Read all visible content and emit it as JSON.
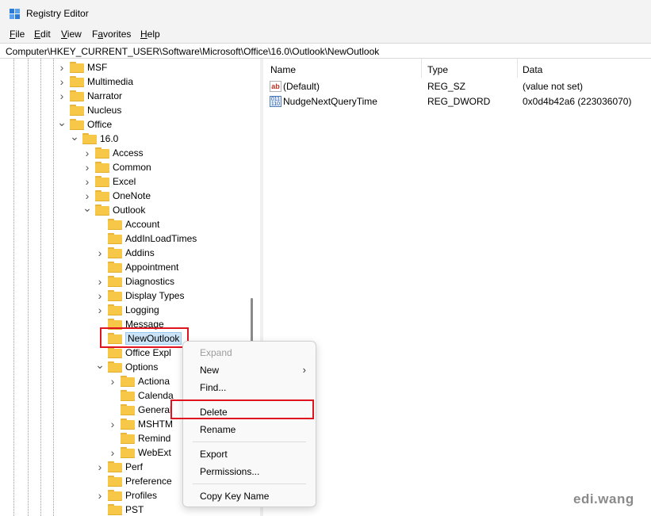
{
  "window": {
    "title": "Registry Editor"
  },
  "menu": [
    "File",
    "Edit",
    "View",
    "Favorites",
    "Help"
  ],
  "menu_mnemonics": [
    "F",
    "E",
    "V",
    "a",
    "H"
  ],
  "address": "Computer\\HKEY_CURRENT_USER\\Software\\Microsoft\\Office\\16.0\\Outlook\\NewOutlook",
  "tree": [
    {
      "label": "MSF",
      "chev": "right"
    },
    {
      "label": "Multimedia",
      "chev": "right"
    },
    {
      "label": "Narrator",
      "chev": "right"
    },
    {
      "label": "Nucleus",
      "chev": "none"
    },
    {
      "label": "Office",
      "chev": "down"
    },
    {
      "label": "16.0",
      "chev": "down"
    },
    {
      "label": "Access",
      "chev": "right"
    },
    {
      "label": "Common",
      "chev": "right"
    },
    {
      "label": "Excel",
      "chev": "right"
    },
    {
      "label": "OneNote",
      "chev": "right"
    },
    {
      "label": "Outlook",
      "chev": "down"
    },
    {
      "label": "Account",
      "chev": "none"
    },
    {
      "label": "AddInLoadTimes",
      "chev": "none"
    },
    {
      "label": "Addins",
      "chev": "right"
    },
    {
      "label": "Appointment",
      "chev": "none"
    },
    {
      "label": "Diagnostics",
      "chev": "right"
    },
    {
      "label": "Display Types",
      "chev": "right"
    },
    {
      "label": "Logging",
      "chev": "right"
    },
    {
      "label": "Message",
      "chev": "none"
    },
    {
      "label": "NewOutlook",
      "chev": "none",
      "selected": true
    },
    {
      "label": "Office Expl",
      "chev": "none"
    },
    {
      "label": "Options",
      "chev": "down"
    },
    {
      "label": "Actiona",
      "chev": "right"
    },
    {
      "label": "Calenda",
      "chev": "none"
    },
    {
      "label": "General",
      "chev": "none"
    },
    {
      "label": "MSHTM",
      "chev": "right"
    },
    {
      "label": "Remind",
      "chev": "none"
    },
    {
      "label": "WebExt",
      "chev": "right"
    },
    {
      "label": "Perf",
      "chev": "right"
    },
    {
      "label": "Preference",
      "chev": "none"
    },
    {
      "label": "Profiles",
      "chev": "right"
    },
    {
      "label": "PST",
      "chev": "none"
    }
  ],
  "columns": {
    "name": "Name",
    "type": "Type",
    "data": "Data"
  },
  "values": [
    {
      "icon": "string-value-icon",
      "name": "(Default)",
      "type": "REG_SZ",
      "data": "(value not set)"
    },
    {
      "icon": "binary-value-icon",
      "name": "NudgeNextQueryTime",
      "type": "REG_DWORD",
      "data": "0x0d4b42a6 (223036070)"
    }
  ],
  "context_menu": [
    {
      "label": "Expand",
      "disabled": true
    },
    {
      "label": "New",
      "submenu": true
    },
    {
      "label": "Find..."
    },
    {
      "sep": true
    },
    {
      "label": "Delete",
      "highlight": true
    },
    {
      "label": "Rename"
    },
    {
      "sep": true
    },
    {
      "label": "Export"
    },
    {
      "label": "Permissions..."
    },
    {
      "sep": true
    },
    {
      "label": "Copy Key Name"
    }
  ],
  "watermark": "edi.wang",
  "colors": {
    "folder": "#f7c847",
    "selection": "#cce4f7",
    "highlight_box": "#e0141e"
  }
}
